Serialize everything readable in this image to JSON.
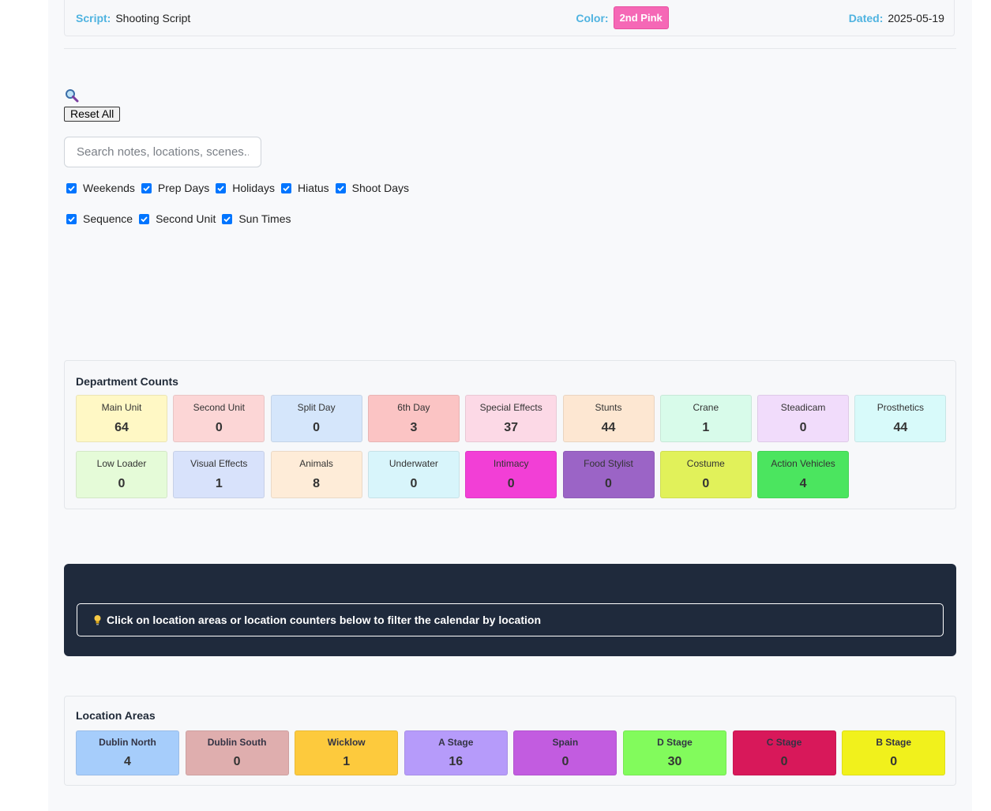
{
  "script_bar": {
    "script_label": "Script:",
    "script_value": "Shooting Script",
    "color_label": "Color:",
    "color_value": "2nd Pink",
    "color_hex": "#f568b6",
    "dated_label": "Dated:",
    "dated_value": "2025-05-19"
  },
  "filters": {
    "reset_label": "Reset All",
    "search_placeholder": "Search notes, locations, scenes...",
    "checkboxes_row1": [
      "Weekends",
      "Prep Days",
      "Holidays",
      "Hiatus",
      "Shoot Days"
    ],
    "checkboxes_row2": [
      "Sequence",
      "Second Unit",
      "Sun Times"
    ]
  },
  "department_counts": {
    "title": "Department Counts",
    "items": [
      {
        "label": "Main Unit",
        "value": "64",
        "color": "#fff8c5"
      },
      {
        "label": "Second Unit",
        "value": "0",
        "color": "#fcd6d6"
      },
      {
        "label": "Split Day",
        "value": "0",
        "color": "#d5e6fb"
      },
      {
        "label": "6th Day",
        "value": "3",
        "color": "#fbc4c4"
      },
      {
        "label": "Special Effects",
        "value": "37",
        "color": "#fcd9e6"
      },
      {
        "label": "Stunts",
        "value": "44",
        "color": "#fde7d2"
      },
      {
        "label": "Crane",
        "value": "1",
        "color": "#d8fbea"
      },
      {
        "label": "Steadicam",
        "value": "0",
        "color": "#f1dcfb"
      },
      {
        "label": "Prosthetics",
        "value": "44",
        "color": "#d8fafa"
      },
      {
        "label": "Low Loader",
        "value": "0",
        "color": "#e5fbd8"
      },
      {
        "label": "Visual Effects",
        "value": "1",
        "color": "#d8e2fb"
      },
      {
        "label": "Animals",
        "value": "8",
        "color": "#feecd8"
      },
      {
        "label": "Underwater",
        "value": "0",
        "color": "#d8f5fb"
      },
      {
        "label": "Intimacy",
        "value": "0",
        "color": "#f23fd6"
      },
      {
        "label": "Food Stylist",
        "value": "0",
        "color": "#9b64c6"
      },
      {
        "label": "Costume",
        "value": "0",
        "color": "#e1f15a"
      },
      {
        "label": "Action Vehicles",
        "value": "4",
        "color": "#4be55f"
      }
    ]
  },
  "info": {
    "message": "Click on location areas or location counters below to filter the calendar by location",
    "icon": "lightbulb-icon"
  },
  "location_areas": {
    "title": "Location Areas",
    "items": [
      {
        "label": "Dublin North",
        "value": "4",
        "color": "#a6cdfb"
      },
      {
        "label": "Dublin South",
        "value": "0",
        "color": "#dfaeae"
      },
      {
        "label": "Wicklow",
        "value": "1",
        "color": "#fdca3d"
      },
      {
        "label": "A Stage",
        "value": "16",
        "color": "#b69bfa"
      },
      {
        "label": "Spain",
        "value": "0",
        "color": "#c25ce0"
      },
      {
        "label": "D Stage",
        "value": "30",
        "color": "#82fb5c"
      },
      {
        "label": "C Stage",
        "value": "0",
        "color": "#d8185a"
      },
      {
        "label": "B Stage",
        "value": "0",
        "color": "#f1f11c"
      }
    ]
  }
}
